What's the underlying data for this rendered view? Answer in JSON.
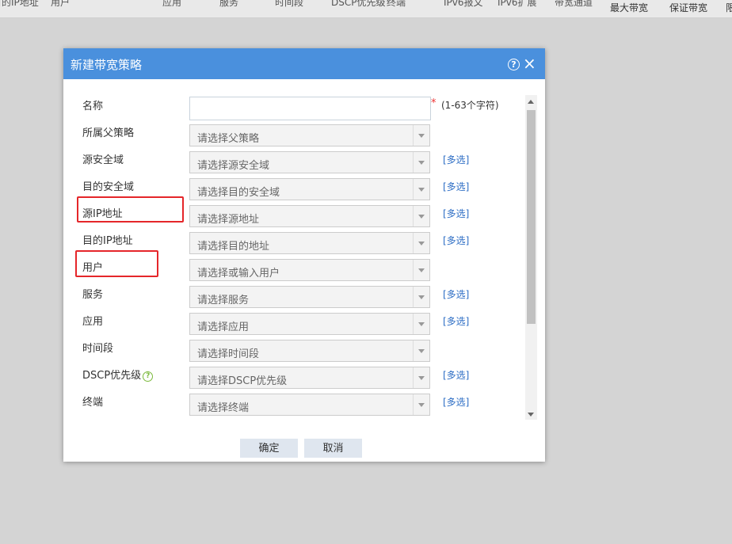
{
  "background_table": {
    "header_row1": [
      "目的IP地址",
      "用户",
      "应用",
      "服务",
      "时间段",
      "DSCP优先级",
      "终端",
      "IPv6报文",
      "IPv6扩展",
      "带宽通道"
    ],
    "header_row2": [
      "最大带宽",
      "保证带宽",
      "限"
    ]
  },
  "dialog": {
    "title": "新建带宽策略",
    "help_icon": "?",
    "close_icon": "×",
    "fields": [
      {
        "label": "名称",
        "type": "text",
        "value": "",
        "required_mark": "*",
        "hint": "(1-63个字符)"
      },
      {
        "label": "所属父策略",
        "type": "select",
        "placeholder": "请选择父策略",
        "multi": ""
      },
      {
        "label": "源安全域",
        "type": "select",
        "placeholder": "请选择源安全域",
        "multi": "[多选]"
      },
      {
        "label": "目的安全域",
        "type": "select",
        "placeholder": "请选择目的安全域",
        "multi": "[多选]"
      },
      {
        "label": "源IP地址",
        "type": "select",
        "placeholder": "请选择源地址",
        "multi": "[多选]"
      },
      {
        "label": "目的IP地址",
        "type": "select",
        "placeholder": "请选择目的地址",
        "multi": "[多选]"
      },
      {
        "label": "用户",
        "type": "select",
        "placeholder": "请选择或输入用户",
        "multi": ""
      },
      {
        "label": "服务",
        "type": "select",
        "placeholder": "请选择服务",
        "multi": "[多选]"
      },
      {
        "label": "应用",
        "type": "select",
        "placeholder": "请选择应用",
        "multi": "[多选]"
      },
      {
        "label": "时间段",
        "type": "select",
        "placeholder": "请选择时间段",
        "multi": ""
      },
      {
        "label": "DSCP优先级",
        "type": "select",
        "placeholder": "请选择DSCP优先级",
        "multi": "[多选]",
        "help": "?"
      },
      {
        "label": "终端",
        "type": "select",
        "placeholder": "请选择终端",
        "multi": "[多选]"
      }
    ],
    "buttons": {
      "ok": "确定",
      "cancel": "取消"
    }
  },
  "colors": {
    "titlebar": "#4a90dd",
    "highlight": "#e5262a",
    "link": "#2b6cc4",
    "button_bg": "#dfe6ef"
  }
}
